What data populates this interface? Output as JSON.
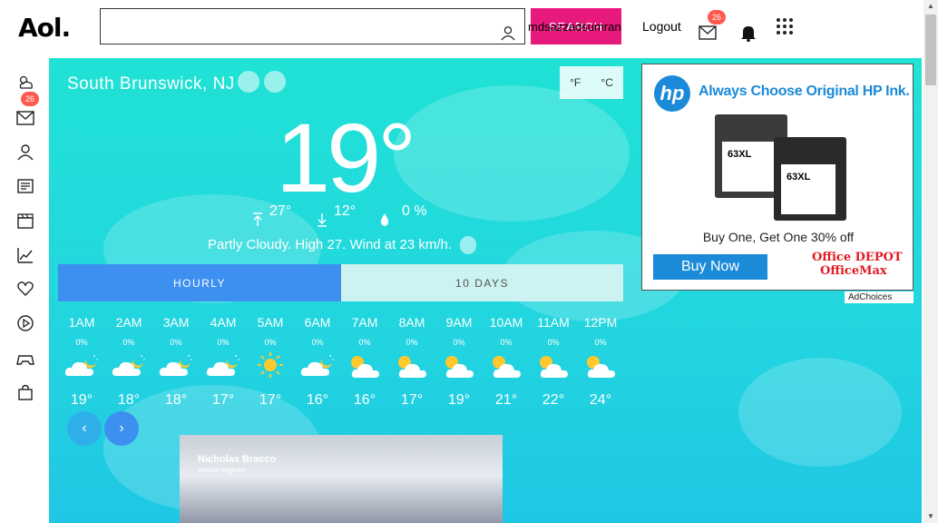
{
  "header": {
    "logo": "Aol.",
    "search_placeholder": "",
    "search_button": "SEARCH",
    "username": "mdsazzadsumran",
    "logout": "Logout",
    "mail_count": "26"
  },
  "rail": {
    "mail_count": "26",
    "items": [
      "weather-icon",
      "mail-icon",
      "user-icon",
      "news-icon",
      "video-icon",
      "finance-icon",
      "lifestyle-icon",
      "play-icon",
      "games-icon",
      "shopping-icon"
    ]
  },
  "weather": {
    "location": "South Brunswick, NJ",
    "unit_f": "°F",
    "unit_c": "°C",
    "current_temp": "19°",
    "high": "27°",
    "low": "12°",
    "precip": "0 %",
    "summary": "Partly Cloudy. High 27. Wind at 23 km/h.",
    "tabs": [
      "HOURLY",
      "10 DAYS"
    ],
    "hourly": [
      {
        "time": "1AM",
        "precip": "0%",
        "icon": "partly-cloudy-night-icon",
        "temp": "19°"
      },
      {
        "time": "2AM",
        "precip": "0%",
        "icon": "partly-cloudy-night-icon",
        "temp": "18°"
      },
      {
        "time": "3AM",
        "precip": "0%",
        "icon": "partly-cloudy-night-icon",
        "temp": "18°"
      },
      {
        "time": "4AM",
        "precip": "0%",
        "icon": "partly-cloudy-night-icon",
        "temp": "17°"
      },
      {
        "time": "5AM",
        "precip": "0%",
        "icon": "sunny-icon",
        "temp": "17°"
      },
      {
        "time": "6AM",
        "precip": "0%",
        "icon": "partly-cloudy-night-icon",
        "temp": "16°"
      },
      {
        "time": "7AM",
        "precip": "0%",
        "icon": "partly-cloudy-day-icon",
        "temp": "16°"
      },
      {
        "time": "8AM",
        "precip": "0%",
        "icon": "partly-cloudy-day-icon",
        "temp": "17°"
      },
      {
        "time": "9AM",
        "precip": "0%",
        "icon": "partly-cloudy-day-icon",
        "temp": "19°"
      },
      {
        "time": "10AM",
        "precip": "0%",
        "icon": "partly-cloudy-day-icon",
        "temp": "21°"
      },
      {
        "time": "11AM",
        "precip": "0%",
        "icon": "partly-cloudy-day-icon",
        "temp": "22°"
      },
      {
        "time": "12PM",
        "precip": "0%",
        "icon": "partly-cloudy-day-icon",
        "temp": "24°"
      }
    ],
    "video": {
      "name": "Nicholas Bracco",
      "role": "Verizon Engineer"
    }
  },
  "ad": {
    "headline": "Always Choose Original HP Ink.",
    "ink_label_1": "63XL",
    "ink_label_2": "63XL",
    "offer": "Buy One, Get One 30% off",
    "button": "Buy Now",
    "brand_1": "Office DEPOT",
    "brand_2": "OfficeMax",
    "adchoices": "AdChoices"
  },
  "colors": {
    "search_button": "#e8197d",
    "badge": "#ff5a50",
    "tab_active": "#3d8ff0",
    "weather_bg": "#22d6df",
    "hp_blue": "#1b8ad8",
    "office_red": "#e31b23"
  }
}
